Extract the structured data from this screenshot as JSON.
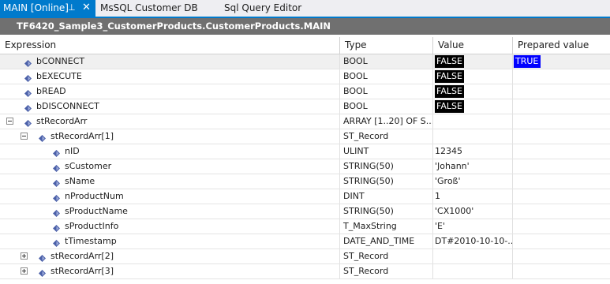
{
  "tabs": [
    {
      "label": "MAIN [Online]",
      "active": true
    },
    {
      "label": "MsSQL Customer DB"
    },
    {
      "label": "Sql Query Editor"
    }
  ],
  "path_title": "TF6420_Sample3_CustomerProducts.CustomerProducts.MAIN",
  "columns": {
    "expression": "Expression",
    "type": "Type",
    "value": "Value",
    "prepared": "Prepared value"
  },
  "rows": [
    {
      "name": "bCONNECT",
      "type": "BOOL",
      "value": "FALSE",
      "prepared": "TRUE"
    },
    {
      "name": "bEXECUTE",
      "type": "BOOL",
      "value": "FALSE",
      "prepared": ""
    },
    {
      "name": "bREAD",
      "type": "BOOL",
      "value": "FALSE",
      "prepared": ""
    },
    {
      "name": "bDISCONNECT",
      "type": "BOOL",
      "value": "FALSE",
      "prepared": ""
    },
    {
      "name": "stRecordArr",
      "type": "ARRAY [1..20] OF S...",
      "value": "",
      "prepared": ""
    },
    {
      "name": "stRecordArr[1]",
      "type": "ST_Record",
      "value": "",
      "prepared": ""
    },
    {
      "name": "nID",
      "type": "ULINT",
      "value": "12345",
      "prepared": ""
    },
    {
      "name": "sCustomer",
      "type": "STRING(50)",
      "value": "'Johann'",
      "prepared": ""
    },
    {
      "name": "sName",
      "type": "STRING(50)",
      "value": "'Groß'",
      "prepared": ""
    },
    {
      "name": "nProductNum",
      "type": "DINT",
      "value": "1",
      "prepared": ""
    },
    {
      "name": "sProductName",
      "type": "STRING(50)",
      "value": "'CX1000'",
      "prepared": ""
    },
    {
      "name": "sProductInfo",
      "type": "T_MaxString",
      "value": "'E'",
      "prepared": ""
    },
    {
      "name": "tTimestamp",
      "type": "DATE_AND_TIME",
      "value": "DT#2010-10-10-...",
      "prepared": ""
    },
    {
      "name": "stRecordArr[2]",
      "type": "ST_Record",
      "value": "",
      "prepared": ""
    },
    {
      "name": "stRecordArr[3]",
      "type": "ST_Record",
      "value": "",
      "prepared": ""
    }
  ],
  "colors": {
    "accent": "#007acc",
    "bool_value_bg": "#000000",
    "prepared_value_bg": "#0000ff",
    "title_bar_bg": "#707070"
  },
  "icons": {
    "variable": "variable-diamond-icon",
    "expand": "expand-plus-icon",
    "collapse": "collapse-minus-icon"
  }
}
